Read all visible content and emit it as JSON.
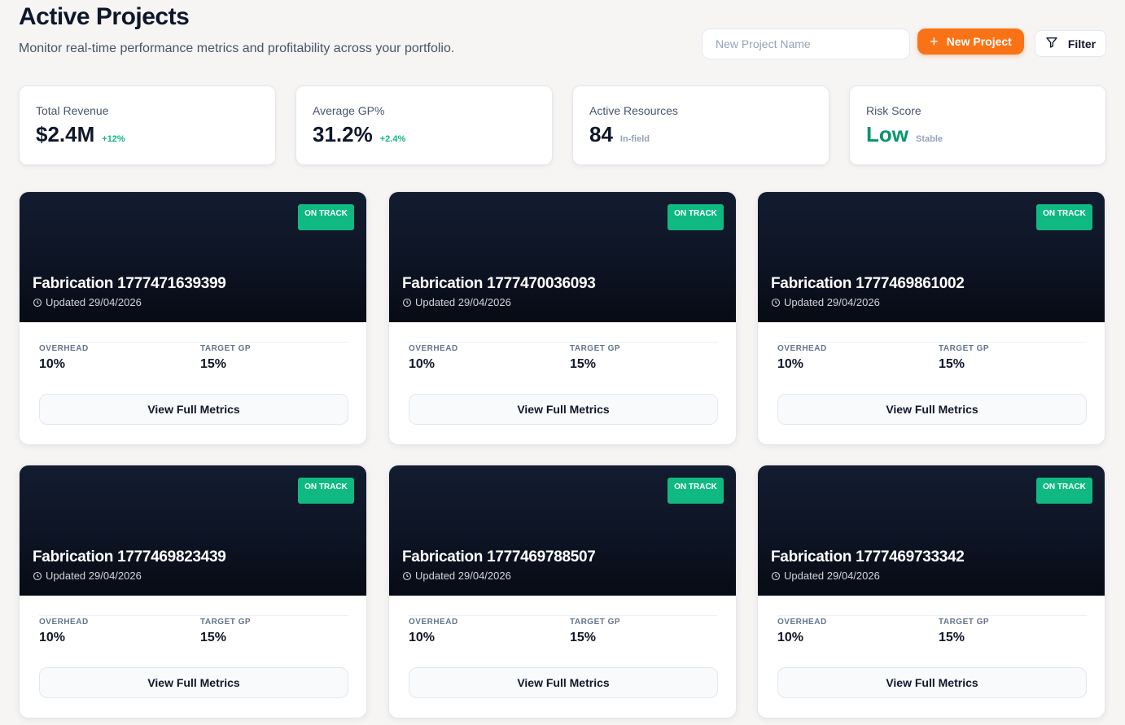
{
  "header": {
    "title": "Active Projects",
    "subtitle": "Monitor real-time performance metrics and profitability across your portfolio.",
    "search_placeholder": "New Project Name",
    "new_button_label": "New Project",
    "filter_button_label": "Filter"
  },
  "stats": [
    {
      "label": "Total Revenue",
      "value": "$2.4M",
      "note": "+12%",
      "note_kind": "delta"
    },
    {
      "label": "Average GP%",
      "value": "31.2%",
      "note": "+2.4%",
      "note_kind": "delta"
    },
    {
      "label": "Active Resources",
      "value": "84",
      "note": "In-field",
      "note_kind": "muted"
    },
    {
      "label": "Risk Score",
      "value": "Low",
      "note": "Stable",
      "note_kind": "muted",
      "value_color": "#059669"
    }
  ],
  "projects": [
    {
      "status": "ON TRACK",
      "name": "Fabrication 1777471639399",
      "updated": "Updated 29/04/2026",
      "overhead_label": "OVERHEAD",
      "overhead": "10%",
      "target_label": "TARGET GP",
      "target": "15%",
      "button": "View Full Metrics"
    },
    {
      "status": "ON TRACK",
      "name": "Fabrication 1777470036093",
      "updated": "Updated 29/04/2026",
      "overhead_label": "OVERHEAD",
      "overhead": "10%",
      "target_label": "TARGET GP",
      "target": "15%",
      "button": "View Full Metrics"
    },
    {
      "status": "ON TRACK",
      "name": "Fabrication 1777469861002",
      "updated": "Updated 29/04/2026",
      "overhead_label": "OVERHEAD",
      "overhead": "10%",
      "target_label": "TARGET GP",
      "target": "15%",
      "button": "View Full Metrics"
    },
    {
      "status": "ON TRACK",
      "name": "Fabrication 1777469823439",
      "updated": "Updated 29/04/2026",
      "overhead_label": "OVERHEAD",
      "overhead": "10%",
      "target_label": "TARGET GP",
      "target": "15%",
      "button": "View Full Metrics"
    },
    {
      "status": "ON TRACK",
      "name": "Fabrication 1777469788507",
      "updated": "Updated 29/04/2026",
      "overhead_label": "OVERHEAD",
      "overhead": "10%",
      "target_label": "TARGET GP",
      "target": "15%",
      "button": "View Full Metrics"
    },
    {
      "status": "ON TRACK",
      "name": "Fabrication 1777469733342",
      "updated": "Updated 29/04/2026",
      "overhead_label": "OVERHEAD",
      "overhead": "10%",
      "target_label": "TARGET GP",
      "target": "15%",
      "button": "View Full Metrics"
    }
  ],
  "icons": {
    "new_button": "plus-icon",
    "filter_button": "filter-icon",
    "updated": "clock-icon"
  },
  "colors": {
    "accent": "#f97316",
    "status_on_track": "#10b981",
    "positive": "#10b981",
    "card_header": "#0d1424"
  }
}
